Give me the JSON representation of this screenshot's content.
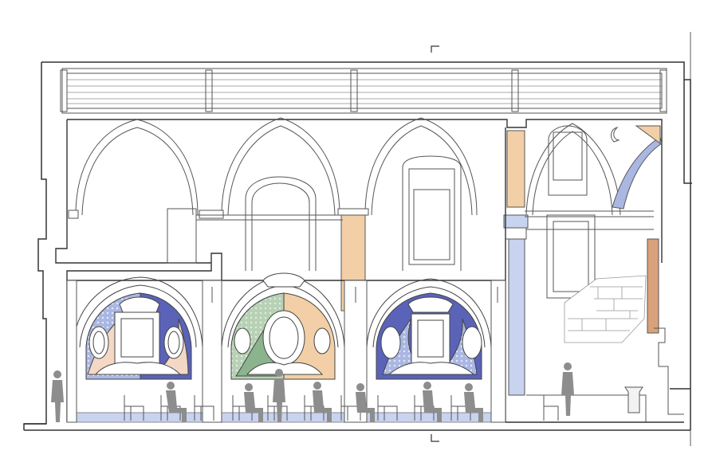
{
  "title": "",
  "colors": {
    "line": "#3a3a3a",
    "thin": "#6e6e6e",
    "paper": "#ffffff",
    "blue": "#5a63b8",
    "blue_pale": "#aab7e2",
    "pale_blue_band": "#c7d3ef",
    "peach": "#f2cfa6",
    "green": "#8bb48e",
    "plaster": "#fde9d2",
    "grey_fig": "#8d8d8d",
    "stone": "#bdbdbd"
  },
  "icons": {
    "section_mark_top": "section-marker-icon",
    "section_mark_bottom": "section-marker-icon"
  },
  "bays": [
    {
      "name": "bay-1",
      "fresco": "blue-peach"
    },
    {
      "name": "bay-2",
      "fresco": "green-peach"
    },
    {
      "name": "bay-3",
      "fresco": "blue"
    },
    {
      "name": "bay-4",
      "fresco": "none"
    }
  ],
  "figures": {
    "standing": 4,
    "seated": 8
  }
}
